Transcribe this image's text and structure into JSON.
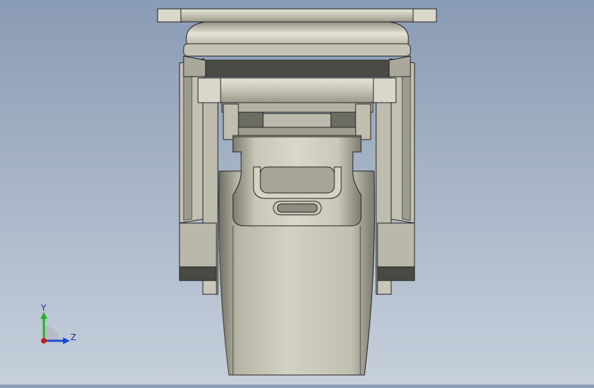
{
  "viewport": {
    "colors": {
      "background_top": "#8a9bb5",
      "background_bottom": "#c6cfdb",
      "metal": "#c9c8b8",
      "edge": "#1e1e1e"
    }
  },
  "triad": {
    "y_label": "Y",
    "z_label": "Z",
    "x_color": "#d01818",
    "y_color": "#18b818",
    "z_color": "#1848d8"
  }
}
